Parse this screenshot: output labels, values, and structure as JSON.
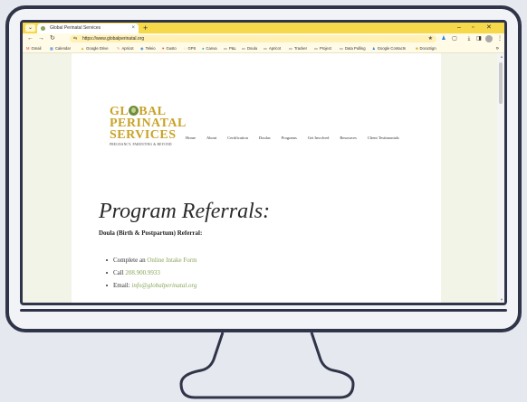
{
  "browser": {
    "tab_title": "Global Perinatal Services",
    "new_tab": "+",
    "url": "https://www.globalperinatal.org",
    "bookmarks": [
      "Gmail",
      "Calendar",
      "Google Drive",
      "Apricot",
      "Teleio",
      "Gusto",
      "GPS",
      "Canva",
      "P&L",
      "Doula",
      "Apricot",
      "Tracker",
      "Project",
      "Data Pulling",
      "Google Contacts",
      "DocuSign"
    ],
    "bookmarks_more": "»"
  },
  "site": {
    "logo": {
      "line1a": "GL",
      "line1b": "BAL",
      "line2": "PERINATAL",
      "line3": "SERVICES",
      "tagline": "PREGNANCY, PARENTING & BEYOND"
    },
    "nav": [
      "Home",
      "About",
      "Certification",
      "Doulas",
      "Programs",
      "Get Involved",
      "Resources",
      "Client Testimonials"
    ]
  },
  "content": {
    "heading": "Program Referrals:",
    "subheading": "Doula (Birth & Postpartum) Referral:",
    "items": {
      "intake_prefix": "Complete an ",
      "intake_link": "Online Intake Form",
      "call_prefix": "Call ",
      "phone": "208.900.9933",
      "email_prefix": "Email: ",
      "email": "info@globalperinatal.org"
    }
  },
  "colors": {
    "tabbar": "#f6d94b",
    "logo_gold": "#c9a227",
    "logo_green": "#6f8c3e",
    "link_green": "#8aa55a",
    "monitor_frame": "#2f3448"
  }
}
